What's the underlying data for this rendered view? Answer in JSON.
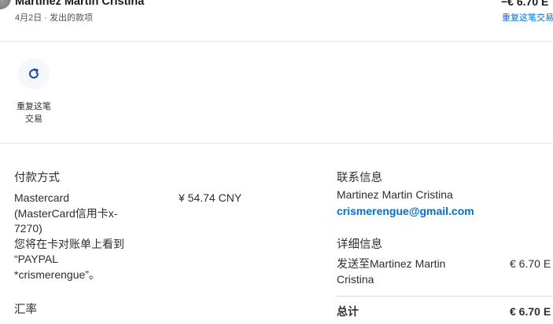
{
  "header": {
    "name": "Martinez Martin Cristina",
    "subtitle": "4月2日 · 发出的款项",
    "amount": "−€ 6.70 E",
    "repeat_link": "重复这笔交易"
  },
  "actions": {
    "repeat_line1": "重复这笔",
    "repeat_line2": "交易"
  },
  "payment": {
    "title": "付款方式",
    "method_lines": [
      "Mastercard",
      "(MasterCard信用卡x-",
      "7270)",
      "您将在卡对账单上看到",
      "“PAYPAL",
      "*crismerengue”。"
    ],
    "amount": "¥ 54.74 CNY"
  },
  "exchange": {
    "title": "汇率"
  },
  "contact": {
    "title": "联系信息",
    "name": "Martinez Martin Cristina",
    "email": "crismerengue@gmail.com"
  },
  "details": {
    "title": "详细信息",
    "sent_to_lines": [
      "发送至Martinez Martin",
      "Cristina"
    ],
    "sent_amount": "€ 6.70 E",
    "total_label": "总计",
    "total_amount": "€ 6.70 E"
  }
}
